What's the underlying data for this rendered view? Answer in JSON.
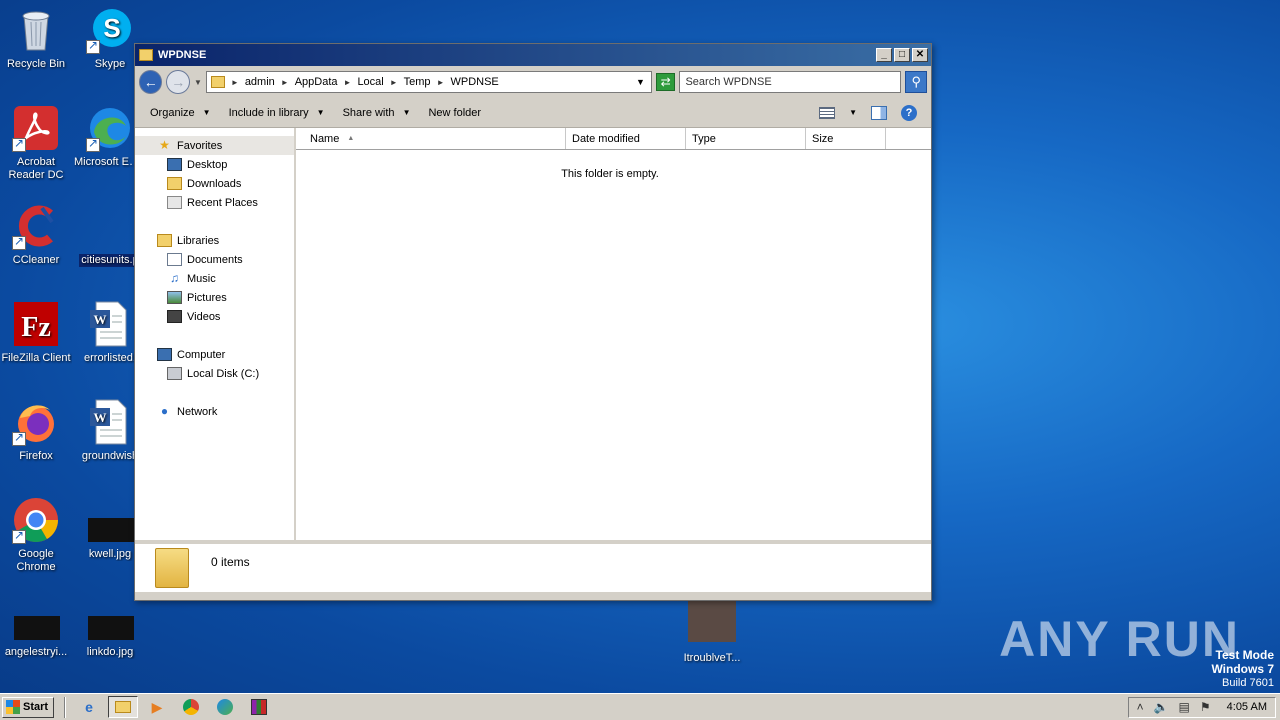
{
  "desktop": {
    "icons": [
      {
        "label": "Recycle Bin"
      },
      {
        "label": "Skype"
      },
      {
        "label": "Acrobat Reader DC"
      },
      {
        "label": "Microsoft Edge"
      },
      {
        "label": "CCleaner"
      },
      {
        "label": "citiesunits.p"
      },
      {
        "label": "FileZilla Client"
      },
      {
        "label": "errorlisted."
      },
      {
        "label": "Firefox"
      },
      {
        "label": "groundwish"
      },
      {
        "label": "Google Chrome"
      },
      {
        "label": "kwell.jpg"
      },
      {
        "label": "angelestryi..."
      },
      {
        "label": "linkdo.jpg"
      },
      {
        "label": "ItroublveT..."
      }
    ],
    "watermark": "ANY RUN",
    "test_mode": {
      "line1": "Test Mode",
      "line2": "Windows 7",
      "line3": "Build 7601"
    }
  },
  "window": {
    "title": "WPDNSE",
    "controls": {
      "minimize": "_",
      "maximize": "□",
      "close": "✕"
    },
    "breadcrumb": [
      "admin",
      "AppData",
      "Local",
      "Temp",
      "WPDNSE"
    ],
    "search_placeholder": "Search WPDNSE",
    "toolbar": {
      "organize": "Organize",
      "include_library": "Include in library",
      "share_with": "Share with",
      "new_folder": "New folder"
    },
    "nav": {
      "favorites": "Favorites",
      "desktop": "Desktop",
      "downloads": "Downloads",
      "recent": "Recent Places",
      "libraries": "Libraries",
      "documents": "Documents",
      "music": "Music",
      "pictures": "Pictures",
      "videos": "Videos",
      "computer": "Computer",
      "local_disk": "Local Disk (C:)",
      "network": "Network"
    },
    "columns": [
      "Name",
      "Date modified",
      "Type",
      "Size"
    ],
    "empty_message": "This folder is empty.",
    "status": "0 items"
  },
  "taskbar": {
    "start": "Start",
    "clock": "4:05 AM"
  }
}
